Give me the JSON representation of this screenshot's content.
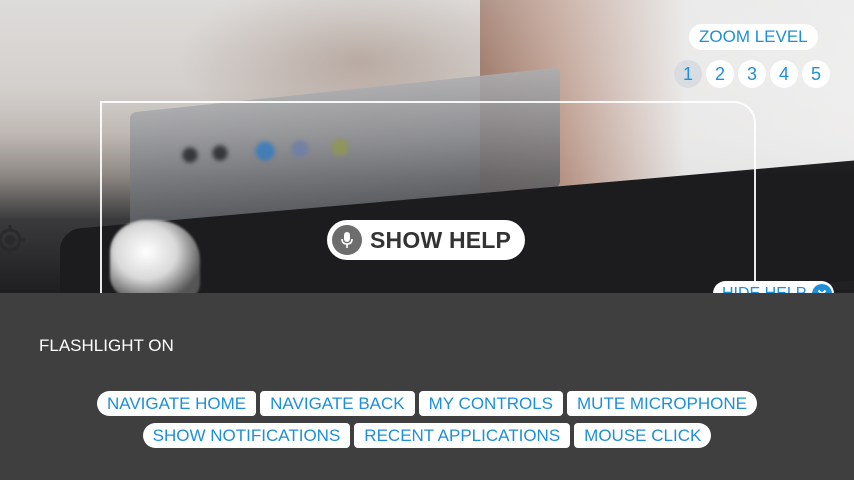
{
  "zoom": {
    "label": "ZOOM LEVEL",
    "levels": [
      "1",
      "2",
      "3",
      "4",
      "5"
    ],
    "current": "1"
  },
  "show_help": {
    "label": "SHOW HELP",
    "icon": "microphone-icon"
  },
  "hide_help": {
    "label": "HIDE HELP",
    "icon": "close-icon"
  },
  "status": {
    "flashlight": "FLASHLIGHT ON"
  },
  "commands": {
    "row1": [
      "NAVIGATE HOME",
      "NAVIGATE BACK",
      "MY CONTROLS",
      "MUTE MICROPHONE"
    ],
    "row2": [
      "SHOW NOTIFICATIONS",
      "RECENT APPLICATIONS",
      "MOUSE CLICK"
    ]
  },
  "colors": {
    "accent": "#1e8fd8",
    "panel": "#3f3f3f",
    "pill": "#ffffff"
  }
}
